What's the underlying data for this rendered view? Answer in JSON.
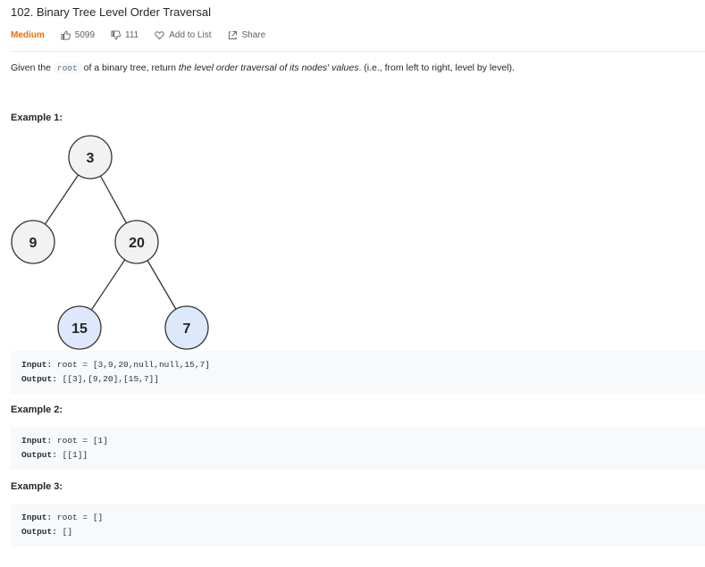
{
  "problem": {
    "title": "102. Binary Tree Level Order Traversal",
    "difficulty": "Medium",
    "likes": "5099",
    "dislikes": "111",
    "add_to_list": "Add to List",
    "share": "Share"
  },
  "description": {
    "prefix": "Given the",
    "code": "root",
    "middle": "of a binary tree, return",
    "emphasis": "the level order traversal of its nodes' values",
    "suffix": ". (i.e., from left to right, level by level)."
  },
  "examples": [
    {
      "title": "Example 1:",
      "tree": {
        "nodes": [
          "3",
          "9",
          "20",
          "15",
          "7"
        ]
      },
      "input_label": "Input:",
      "input_value": "root = [3,9,20,null,null,15,7]",
      "output_label": "Output:",
      "output_value": "[[3],[9,20],[15,7]]"
    },
    {
      "title": "Example 2:",
      "input_label": "Input:",
      "input_value": "root = [1]",
      "output_label": "Output:",
      "output_value": "[[1]]"
    },
    {
      "title": "Example 3:",
      "input_label": "Input:",
      "input_value": "root = []",
      "output_label": "Output:",
      "output_value": "[]"
    }
  ],
  "colors": {
    "difficulty": "#ef6c00",
    "node_fill": "#f2f2f2",
    "node_fill_highlight": "#dde8fb",
    "code_bg": "#f7f9fa"
  }
}
